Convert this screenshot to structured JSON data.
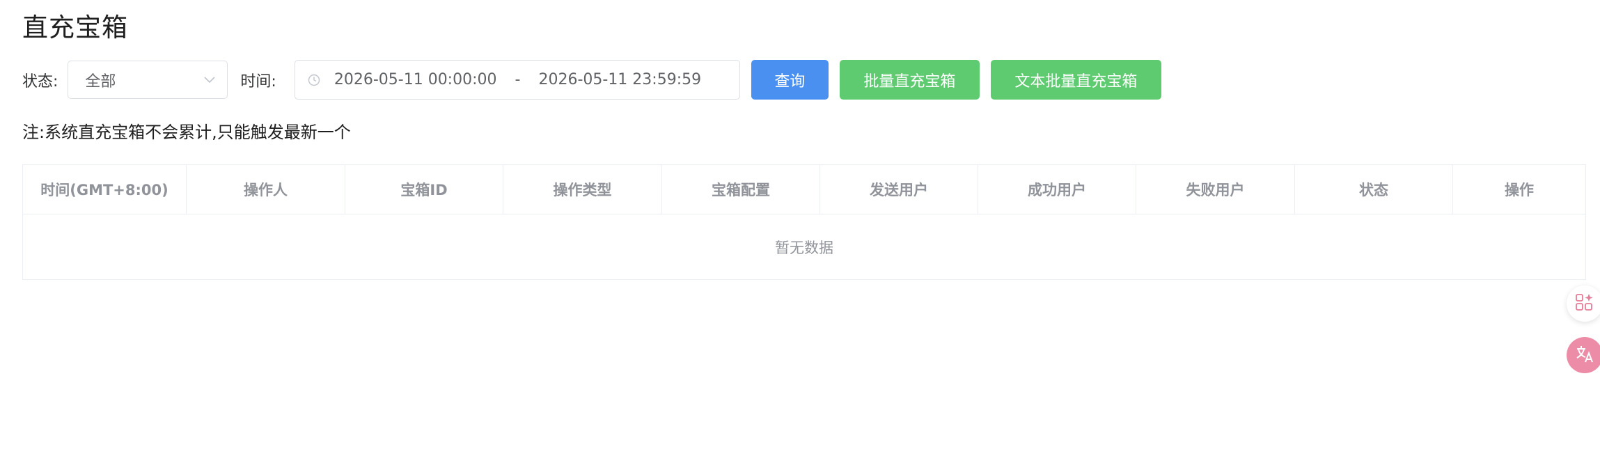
{
  "page": {
    "title": "直充宝箱"
  },
  "filters": {
    "status_label": "状态:",
    "status_value": "全部",
    "time_label": "时间:",
    "date_start": "2026-05-11 00:00:00",
    "date_separator": "-",
    "date_end": "2026-05-11 23:59:59"
  },
  "buttons": {
    "query": "查询",
    "batch_recharge": "批量直充宝箱",
    "text_batch_recharge": "文本批量直充宝箱"
  },
  "note": "注:系统直充宝箱不会累计,只能触发最新一个",
  "table": {
    "columns": [
      "时间(GMT+8:00)",
      "操作人",
      "宝箱ID",
      "操作类型",
      "宝箱配置",
      "发送用户",
      "成功用户",
      "失败用户",
      "状态",
      "操作"
    ],
    "empty_text": "暂无数据"
  },
  "icons": {
    "select_arrow": "chevron-down-icon",
    "date_prefix": "clock-icon",
    "float_apps": "apps-sparkle-icon",
    "float_translate": "translate-icon"
  },
  "colors": {
    "primary": "#4a90f0",
    "success": "#5fcb71",
    "translate_bubble": "#ec8ca6"
  }
}
